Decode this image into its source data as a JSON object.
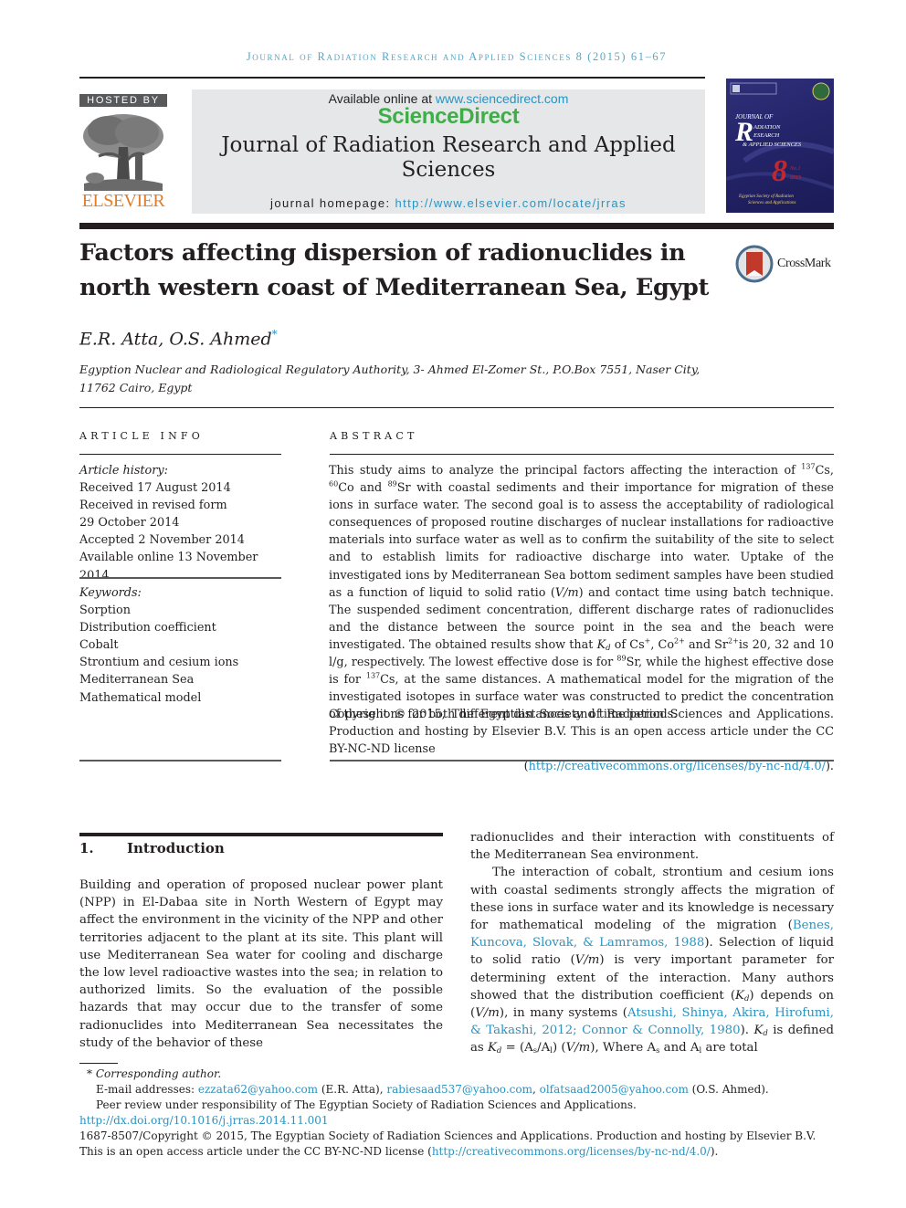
{
  "running_header": "Journal of Radiation Research and Applied Sciences 8 (2015) 61–67",
  "masthead": {
    "hosted_by": "HOSTED BY",
    "publisher": "ELSEVIER",
    "available_online_prefix": "Available online at ",
    "available_online_url": "www.sciencedirect.com",
    "sciencedirect_logo": "ScienceDirect",
    "journal_title_line1": "Journal of Radiation Research and Applied",
    "journal_title_line2": "Sciences",
    "homepage_prefix": "journal homepage: ",
    "homepage_url": "http://www.elsevier.com/locate/jrras",
    "cover": {
      "journal_of": "Journal of",
      "radiation_r": "R",
      "adiation": "adiation",
      "esearch": "esearch",
      "applied_sciences": "& Applied Sciences",
      "volume": "8",
      "issue": "No.1",
      "year": "2015",
      "society": "Egyptian Society of Radiation Sciences and Applications"
    }
  },
  "article": {
    "title_line1": "Factors affecting dispersion of radionuclides in",
    "title_line2": "north western coast of Mediterranean Sea, Egypt",
    "crossmark_label": "CrossMark",
    "authors": "E.R. Atta, O.S. Ahmed",
    "corresponding_marker": "*",
    "affiliation_line1": "Egyption Nuclear and Radiological Regulatory Authority, 3- Ahmed El-Zomer St., P.O.Box 7551, Naser City,",
    "affiliation_line2": "11762 Cairo, Egypt"
  },
  "article_info": {
    "label": "ARTICLE INFO",
    "history_heading": "Article history:",
    "history": [
      "Received 17 August 2014",
      "Received in revised form",
      "29 October 2014",
      "Accepted 2 November 2014",
      "Available online 13 November 2014"
    ],
    "keywords_heading": "Keywords:",
    "keywords": [
      "Sorption",
      "Distribution coefficient",
      "Cobalt",
      "Strontium and cesium ions",
      "Mediterranean Sea",
      "Mathematical model"
    ]
  },
  "abstract": {
    "label": "ABSTRACT",
    "p1_a": "This study aims to analyze the principal factors affecting the interaction of ",
    "iso_cs": "137",
    "p1_b": "Cs, ",
    "iso_co": "60",
    "p1_c": "Co and ",
    "iso_sr": "89",
    "p1_d": "Sr with coastal sediments and their importance for migration of these ions in surface water. The second goal is to assess the acceptability of radiological consequences of proposed routine discharges of nuclear installations for radioactive materials into surface water as well as to confirm the suitability of the site to select and to establish limits for radioactive discharge into water. Uptake of the investigated ions by Mediterranean Sea bottom sediment samples have been studied as a function of liquid to solid ratio (",
    "vm": "V/m",
    "p1_e": ") and contact time using batch technique. The suspended sediment concentration, different discharge rates of radionuclides and the distance between the source point in the sea and the beach were investigated. The obtained results show that ",
    "kd_k": "K",
    "kd_d": "d",
    "p1_f": " of Cs",
    "cs_charge": "+",
    "p1_g": ", Co",
    "co_charge": "2+",
    "p1_h": " and Sr",
    "sr_charge": "2+",
    "p1_i": "is 20, 32 and 10 l/g, respectively. The lowest effective dose is for ",
    "iso_sr2": "89",
    "p1_j": "Sr, while the highest effective dose is for ",
    "iso_cs2": "137",
    "p1_k": "Cs, at the same distances. A mathematical model for the migration of the investigated isotopes in surface water was constructed to predict the concentration of these ions for both different distances and time periods.",
    "copyright": "Copyright © 2015, The Egyptian Society of Radiation Sciences and Applications. Production and hosting by Elsevier B.V. This is an open access article under the CC BY-NC-ND license",
    "license_open": "(",
    "license_url": "http://creativecommons.org/licenses/by-nc-nd/4.0/",
    "license_close": ")."
  },
  "body": {
    "section_number": "1.",
    "section_title": "Introduction",
    "col1_p1": "Building and operation of proposed nuclear power plant (NPP) in El-Dabaa site in North Western of Egypt may affect the environment in the vicinity of the NPP and other territories adjacent to the plant at its site. This plant will use Mediterranean Sea water for cooling and discharge the low level radioactive wastes into the sea; in relation to authorized limits. So the evaluation of the possible hazards that may occur due to the transfer of some radionuclides into Mediterranean Sea necessitates the study of the behavior of these",
    "col2_p1": "radionuclides and their interaction with constituents of the Mediterranean Sea environment.",
    "col2_p2_a": "The interaction of cobalt, strontium and cesium ions with coastal sediments strongly affects the migration of these ions in surface water and its knowledge is necessary for mathematical modeling of the migration (",
    "cite1": "Benes, Kuncova, Slovak, & Lamramos, 1988",
    "col2_p2_b": "). Selection of liquid to solid ratio (",
    "vm": "V/m",
    "col2_p2_c": ") is very important parameter for determining extent of the interaction. Many authors showed that the distribution coefficient (",
    "kd_k": "K",
    "kd_d": "d",
    "col2_p2_d": ") depends on (",
    "col2_p2_e": "), in many systems (",
    "cite2": "Atsushi, Shinya, Akira, Hirofumi, & Takashi, 2012; Connor & Connolly, 1980",
    "col2_p2_f": "). ",
    "col2_p2_g": " is defined as ",
    "col2_p2_h": " = (A",
    "as_sub": "s",
    "slash": "/",
    "al_a": "A",
    "al_sub": "l",
    "col2_p2_i": ") (",
    "col2_p2_j": "), Where ",
    "col2_p2_k": " and ",
    "col2_p2_l": " are total"
  },
  "footnotes": {
    "marker": "*",
    "corresponding": "Corresponding author.",
    "email_prefix": "E-mail addresses: ",
    "email1": "ezzata62@yahoo.com",
    "email1_owner": " (E.R. Atta), ",
    "email2": "rabiesaad537@yahoo.com",
    "sep": ", ",
    "email3": "olfatsaad2005@yahoo.com",
    "email3_owner": " (O.S. Ahmed).",
    "peer_review": "Peer review under responsibility of The Egyptian Society of Radiation Sciences and Applications.",
    "doi": "http://dx.doi.org/10.1016/j.jrras.2014.11.001",
    "issn_copyright": "1687-8507/Copyright © 2015, The Egyptian Society of Radiation Sciences and Applications. Production and hosting by Elsevier B.V. This is an open access article under the CC BY-NC-ND license (",
    "license_url": "http://creativecommons.org/licenses/by-nc-nd/4.0/",
    "license_close": ")."
  },
  "colors": {
    "link": "#2a93c0",
    "sciencedirect_green": "#3fae49",
    "elsevier_orange": "#e07e2b",
    "masthead_gray": "#e6e7e8",
    "running_header": "#56a7c9"
  }
}
